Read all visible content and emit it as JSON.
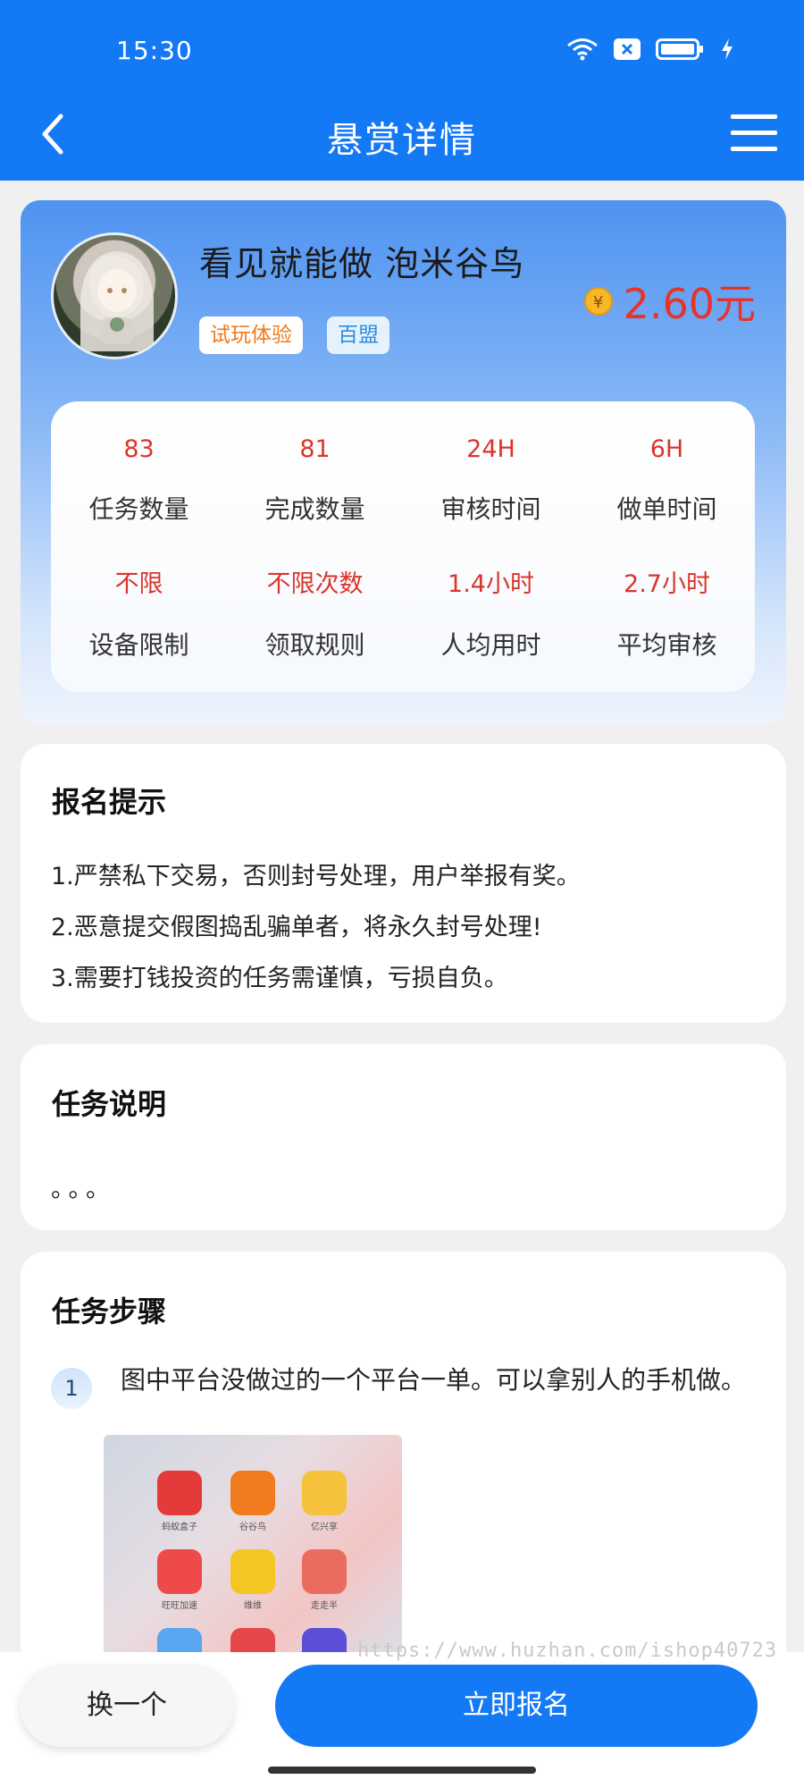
{
  "status_bar": {
    "time": "15:30"
  },
  "nav": {
    "title": "悬赏详情"
  },
  "task": {
    "title": "看见就能做 泡米谷鸟",
    "tags": [
      "试玩体验",
      "百盟"
    ],
    "coin_symbol": "¥",
    "price": "2.60元"
  },
  "stats": [
    {
      "value": "83",
      "label": "任务数量"
    },
    {
      "value": "81",
      "label": "完成数量"
    },
    {
      "value": "24H",
      "label": "审核时间"
    },
    {
      "value": "6H",
      "label": "做单时间"
    },
    {
      "value": "不限",
      "label": "设备限制"
    },
    {
      "value": "不限次数",
      "label": "领取规则"
    },
    {
      "value": "1.4小时",
      "label": "人均用时"
    },
    {
      "value": "2.7小时",
      "label": "平均审核"
    }
  ],
  "signup_tips": {
    "heading": "报名提示",
    "lines": [
      "1.严禁私下交易，否则封号处理，用户举报有奖。",
      "2.恶意提交假图捣乱骗单者，将永久封号处理!",
      "3.需要打钱投资的任务需谨慎，亏损自负。"
    ]
  },
  "task_desc": {
    "heading": "任务说明",
    "text": "。。。"
  },
  "task_steps": {
    "heading": "任务步骤",
    "steps": [
      {
        "number": "1",
        "text": "图中平台没做过的一个平台一单。可以拿别人的手机做。"
      }
    ],
    "screenshot_apps": [
      "蚂蚁盒子",
      "谷谷鸟",
      "亿兴享",
      "旺旺加速",
      "维维",
      "走走半"
    ]
  },
  "buttons": {
    "switch": "换一个",
    "apply": "立即报名"
  },
  "watermark": "https://www.huzhan.com/ishop40723",
  "colors": {
    "primary": "#1479f5",
    "price": "#e8332b",
    "tag_orange": "#f07a1a"
  }
}
